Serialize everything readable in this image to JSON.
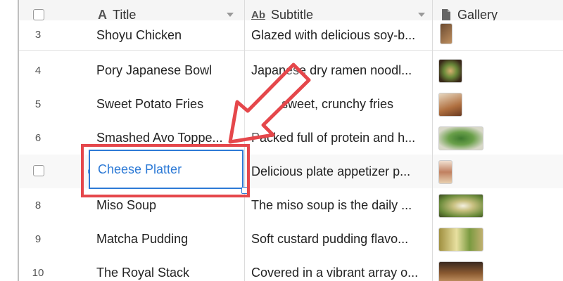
{
  "header": {
    "title_label": "Title",
    "title_icon": "A",
    "subtitle_label": "Subtitle",
    "subtitle_icon": "Ab",
    "gallery_label": "Gallery"
  },
  "rows": [
    {
      "num": "3",
      "title": "Shoyu Chicken",
      "subtitle": "Glazed with delicious soy-b..."
    },
    {
      "num": "4",
      "title": "Pory Japanese Bowl",
      "subtitle": "Japanese dry ramen noodl..."
    },
    {
      "num": "5",
      "title": "Sweet Potato Fries",
      "subtitle": "sweet, crunchy fries"
    },
    {
      "num": "6",
      "title": "Smashed Avo Toppe...",
      "subtitle": "Packed full of protein and h..."
    },
    {
      "num": "",
      "title": "Cheese Platter",
      "subtitle": "Delicious plate appetizer p..."
    },
    {
      "num": "8",
      "title": "Miso Soup",
      "subtitle": "The miso soup is the daily ..."
    },
    {
      "num": "9",
      "title": "Matcha Pudding",
      "subtitle": "Soft custard pudding flavo..."
    },
    {
      "num": "10",
      "title": "The Royal Stack",
      "subtitle": "Covered in a vibrant array o..."
    }
  ],
  "colors": {
    "accent": "#2d7ad6",
    "annotation": "#e5474b"
  }
}
